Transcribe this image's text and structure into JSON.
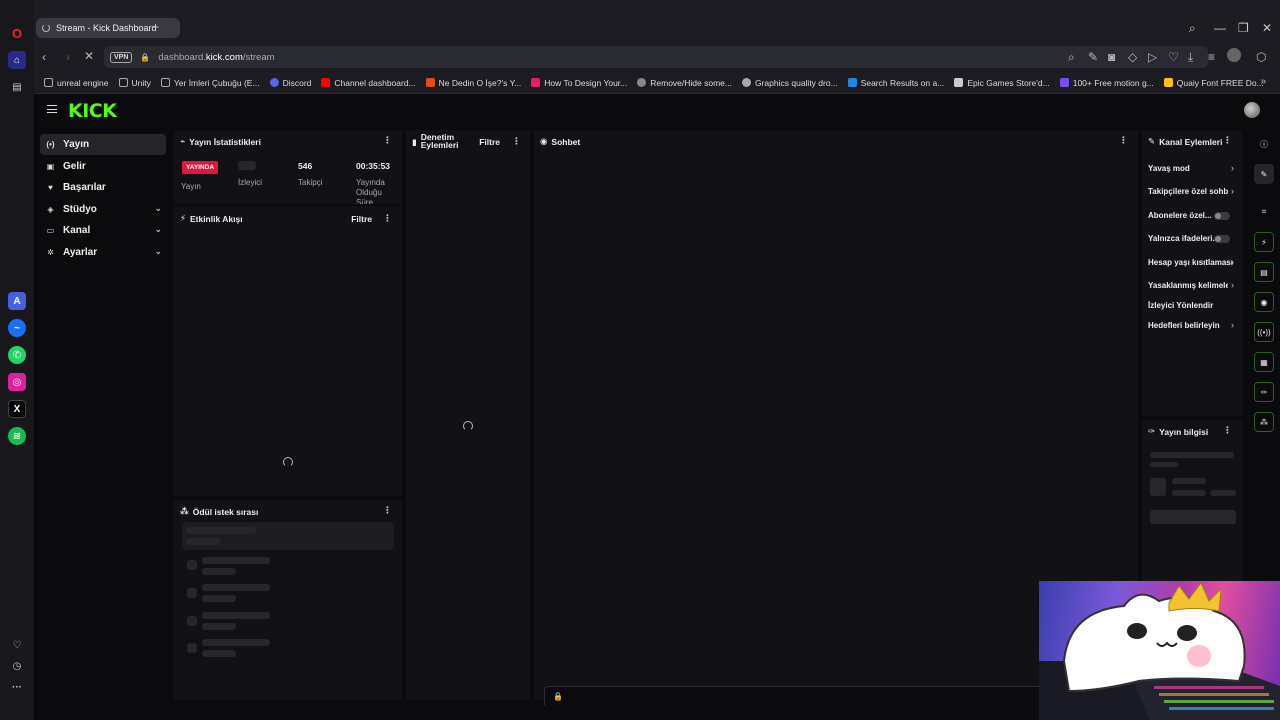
{
  "browser": {
    "tab_title": "Stream - Kick Dashboard",
    "url_prefix": "dashboard.",
    "url_host": "kick.com",
    "url_path": "/stream",
    "vpn_label": "VPN"
  },
  "bookmarks": [
    {
      "label": "unreal engine",
      "color": "#777777"
    },
    {
      "label": "Unity",
      "color": "#777777"
    },
    {
      "label": "Yer İmleri Çubuğu (E...",
      "color": "#777777"
    },
    {
      "label": "Discord",
      "color": "#5865f2"
    },
    {
      "label": "Channel dashboard...",
      "color": "#ff0000"
    },
    {
      "label": "Ne Dedin O İşe?'s Y...",
      "color": "#e64a19"
    },
    {
      "label": "How To Design Your...",
      "color": "#e91e63"
    },
    {
      "label": "Remove/Hide some...",
      "color": "#888888"
    },
    {
      "label": "Graphics quality dro...",
      "color": "#aaaaaa"
    },
    {
      "label": "Search Results on a...",
      "color": "#1e88e5"
    },
    {
      "label": "Epic Games Store'd...",
      "color": "#cccccc"
    },
    {
      "label": "100+ Free motion g...",
      "color": "#7c4dff"
    },
    {
      "label": "Quaiy Font FREE Do...",
      "color": "#ffc107"
    }
  ],
  "nav": {
    "items": [
      {
        "label": "Yayın",
        "icon": "broadcast-icon",
        "glyph": "(•)"
      },
      {
        "label": "Gelir",
        "icon": "wallet-icon",
        "glyph": "▣"
      },
      {
        "label": "Başarılar",
        "icon": "trophy-icon",
        "glyph": "♥"
      },
      {
        "label": "Stüdyo",
        "icon": "studio-icon",
        "glyph": "◈"
      },
      {
        "label": "Kanal",
        "icon": "channel-icon",
        "glyph": "▭"
      },
      {
        "label": "Ayarlar",
        "icon": "gear-icon",
        "glyph": "✲"
      }
    ]
  },
  "stats": {
    "title": "Yayın İstatistikleri",
    "live_badge": "YAYINDA",
    "col1_label": "Yayın",
    "col2_label": "İzleyici",
    "col3_value": "546",
    "col3_label": "Takipçi",
    "col4_value": "00:35:53",
    "col4_label_1": "Yayında",
    "col4_label_2": "Olduğu",
    "col4_label_3": "Süre"
  },
  "activity": {
    "title": "Etkinlik Akışı",
    "filter": "Filtre"
  },
  "moderation": {
    "title_1": "Denetim",
    "title_2": "Eylemleri",
    "filter": "Filtre"
  },
  "chat": {
    "title": "Sohbet"
  },
  "rewards": {
    "title": "Ödül istek sırası"
  },
  "channel_actions": {
    "title": "Kanal Eylemleri",
    "items": [
      "Yavaş mod",
      "Takipçilere özel sohbet",
      "Abonelere özel...",
      "Yalnızca ifadeleri...",
      "Hesap yaşı kısıtlaması",
      "Yasaklanmış kelimeler",
      "İzleyici Yönlendir",
      "Hedefleri belirleyin"
    ]
  },
  "stream_info": {
    "title": "Yayın bilgisi"
  },
  "colors": {
    "kick_green": "#53fc18",
    "live_red": "#e0173d"
  }
}
